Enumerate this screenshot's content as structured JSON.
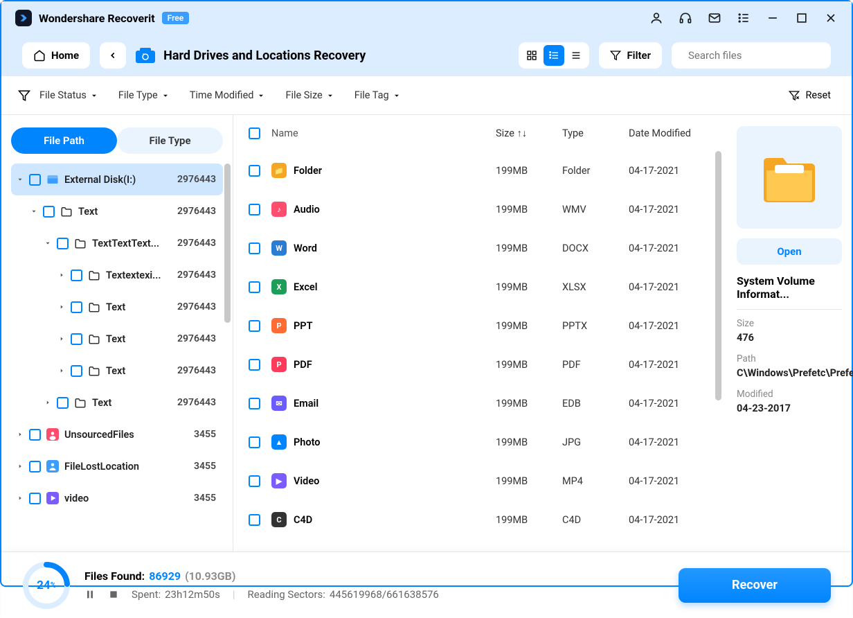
{
  "app": {
    "title": "Wondershare Recoverit",
    "badge": "Free"
  },
  "toolbar": {
    "home": "Home",
    "breadcrumb": "Hard Drives and Locations Recovery",
    "filter": "Filter",
    "search_placeholder": "Search files"
  },
  "filterbar": {
    "file_status": "File Status",
    "file_type": "File Type",
    "time_modified": "Time Modified",
    "file_size": "File Size",
    "file_tag": "File Tag",
    "reset": "Reset"
  },
  "sidebar": {
    "tab_path": "File Path",
    "tab_type": "File Type",
    "tree": [
      {
        "indent": 0,
        "arrow": "down",
        "label": "External Disk(I:)",
        "count": "2976443",
        "icon": "disk",
        "selected": true
      },
      {
        "indent": 1,
        "arrow": "down",
        "label": "Text",
        "count": "2976443",
        "icon": "folder"
      },
      {
        "indent": 2,
        "arrow": "down",
        "label": "TextTextText...",
        "count": "2976443",
        "icon": "folder"
      },
      {
        "indent": 3,
        "arrow": "right",
        "label": "Textextexi...",
        "count": "2976443",
        "icon": "folder"
      },
      {
        "indent": 3,
        "arrow": "right",
        "label": "Text",
        "count": "2976443",
        "icon": "folder"
      },
      {
        "indent": 3,
        "arrow": "right",
        "label": "Text",
        "count": "2976443",
        "icon": "folder"
      },
      {
        "indent": 3,
        "arrow": "right",
        "label": "Text",
        "count": "2976443",
        "icon": "folder"
      },
      {
        "indent": 2,
        "arrow": "right",
        "label": "Text",
        "count": "2976443",
        "icon": "folder"
      },
      {
        "indent": 0,
        "arrow": "right",
        "label": "UnsourcedFiles",
        "count": "3455",
        "icon": "red"
      },
      {
        "indent": 0,
        "arrow": "right",
        "label": "FileLostLocation",
        "count": "3455",
        "icon": "person"
      },
      {
        "indent": 0,
        "arrow": "right",
        "label": "video",
        "count": "3455",
        "icon": "video"
      }
    ]
  },
  "table": {
    "headers": {
      "name": "Name",
      "size": "Size",
      "type": "Type",
      "date": "Date Modified"
    },
    "rows": [
      {
        "name": "Folder",
        "size": "199MB",
        "type": "Folder",
        "date": "04-17-2021",
        "color": "#f5a623",
        "glyph": "📁"
      },
      {
        "name": "Audio",
        "size": "199MB",
        "type": "WMV",
        "date": "04-17-2021",
        "color": "#ff4d6d",
        "glyph": "♪"
      },
      {
        "name": "Word",
        "size": "199MB",
        "type": "DOCX",
        "date": "04-17-2021",
        "color": "#2b7cd3",
        "glyph": "W"
      },
      {
        "name": "Excel",
        "size": "199MB",
        "type": "XLSX",
        "date": "04-17-2021",
        "color": "#1d9f5a",
        "glyph": "X"
      },
      {
        "name": "PPT",
        "size": "199MB",
        "type": "PPTX",
        "date": "04-17-2021",
        "color": "#ff6b35",
        "glyph": "P"
      },
      {
        "name": "PDF",
        "size": "199MB",
        "type": "PDF",
        "date": "04-17-2021",
        "color": "#ff3b5c",
        "glyph": "P"
      },
      {
        "name": "Email",
        "size": "199MB",
        "type": "EDB",
        "date": "04-17-2021",
        "color": "#6b5cff",
        "glyph": "✉"
      },
      {
        "name": "Photo",
        "size": "199MB",
        "type": "JPG",
        "date": "04-17-2021",
        "color": "#0085ff",
        "glyph": "▲"
      },
      {
        "name": "Video",
        "size": "199MB",
        "type": "MP4",
        "date": "04-17-2021",
        "color": "#7c5cff",
        "glyph": "▶"
      },
      {
        "name": "C4D",
        "size": "199MB",
        "type": "C4D",
        "date": "04-17-2021",
        "color": "#333",
        "glyph": "C"
      }
    ]
  },
  "preview": {
    "open": "Open",
    "title": "System Volume Informat...",
    "size_label": "Size",
    "size_value": "476",
    "path_label": "Path",
    "path_value": "C\\Windows\\Prefetc\\Prefetc...",
    "modified_label": "Modified",
    "modified_value": "04-23-2017"
  },
  "footer": {
    "percent": "24",
    "files_found_label": "Files Found:",
    "files_found_count": "86929",
    "files_found_size": "(10.93GB)",
    "spent_label": "Spent:",
    "spent_value": "23h12m50s",
    "reading_label": "Reading Sectors:",
    "reading_value": "445619968/661638576",
    "recover": "Recover"
  }
}
